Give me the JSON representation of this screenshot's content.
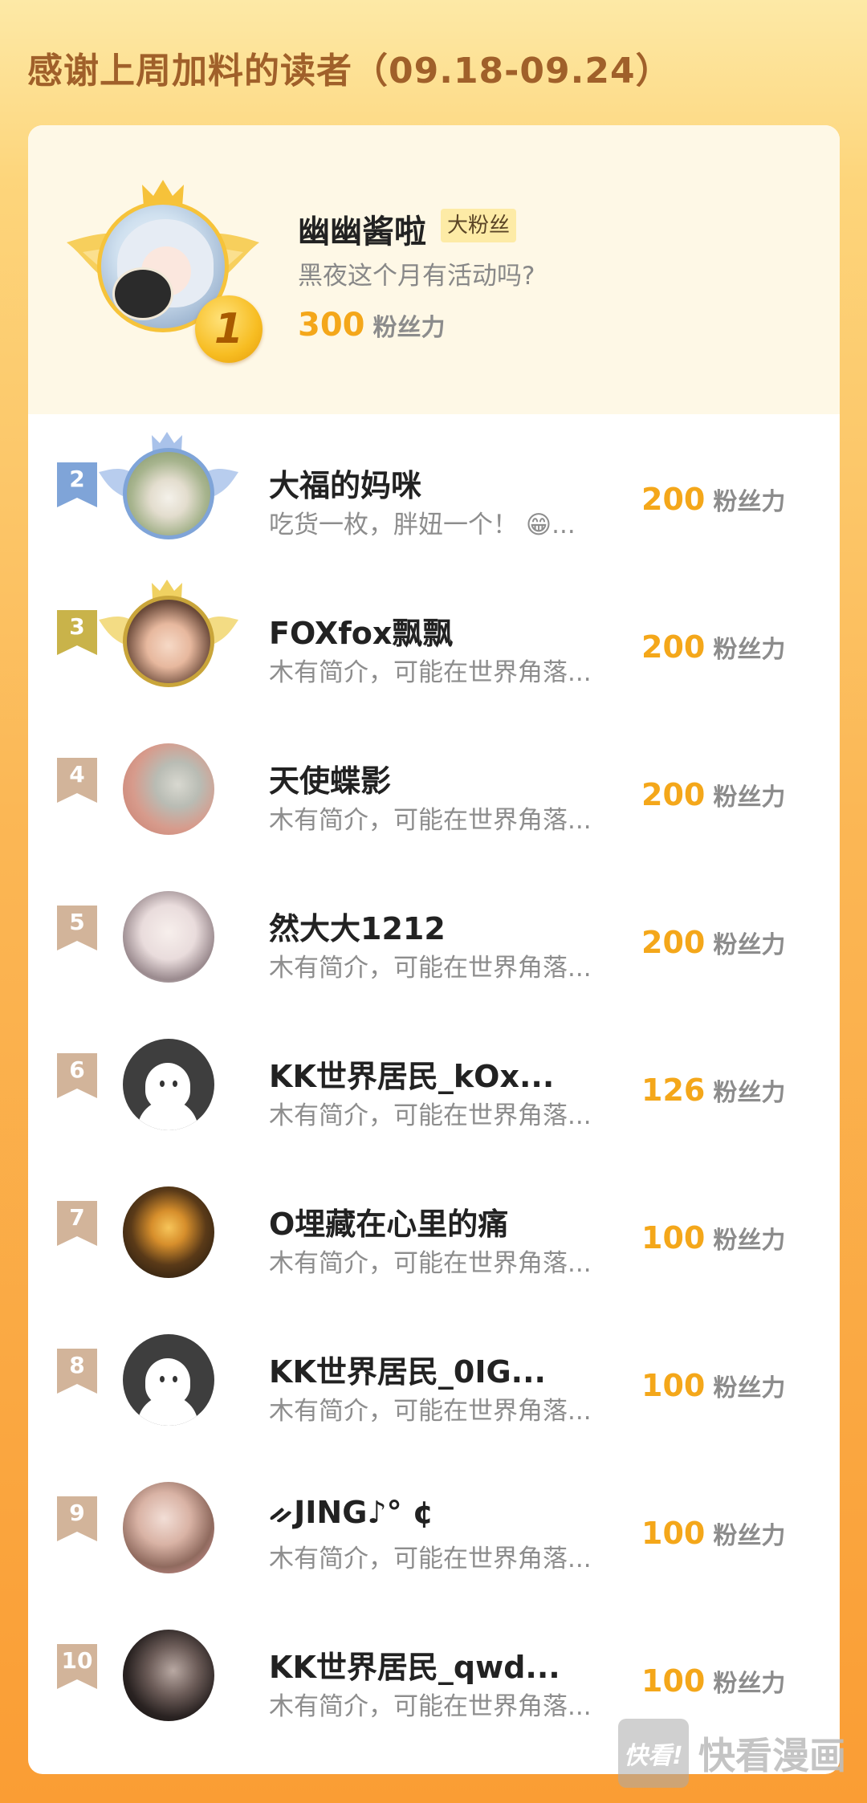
{
  "title": "感谢上周加料的读者（09.18-09.24）",
  "score_unit": "粉丝力",
  "top": {
    "rank": "1",
    "name": "幽幽酱啦",
    "badge": "大粉丝",
    "desc": "黑夜这个月有活动吗?",
    "score": "300"
  },
  "readers": [
    {
      "rank": "2",
      "name": "大福的妈咪",
      "desc": "吃货一枚，胖妞一个！ 😁...",
      "score": "200"
    },
    {
      "rank": "3",
      "name": "FOXfox飘飘",
      "desc": "木有简介，可能在世界角落...",
      "score": "200"
    },
    {
      "rank": "4",
      "name": "天使蝶影",
      "desc": "木有简介，可能在世界角落...",
      "score": "200"
    },
    {
      "rank": "5",
      "name": "然大大1212",
      "desc": "木有简介，可能在世界角落...",
      "score": "200"
    },
    {
      "rank": "6",
      "name": "KK世界居民_kOx...",
      "desc": "木有简介，可能在世界角落...",
      "score": "126"
    },
    {
      "rank": "7",
      "name": "O埋藏在心里的痛",
      "desc": "木有简介，可能在世界角落...",
      "score": "100"
    },
    {
      "rank": "8",
      "name": "KK世界居民_0IG...",
      "desc": "木有简介，可能在世界角落...",
      "score": "100"
    },
    {
      "rank": "9",
      "name": "ᨀJING♪° ¢",
      "desc": "木有简介，可能在世界角落...",
      "score": "100"
    },
    {
      "rank": "10",
      "name": "KK世界居民_qwd...",
      "desc": "木有简介，可能在世界角落...",
      "score": "100"
    }
  ],
  "watermark": {
    "logo": "快看!",
    "text": "快看漫画"
  },
  "colors": {
    "score": "#f4a71a",
    "rank2": "#7fa4d8",
    "rank3": "#c9b34a",
    "rank_other": "#d2b49a"
  }
}
